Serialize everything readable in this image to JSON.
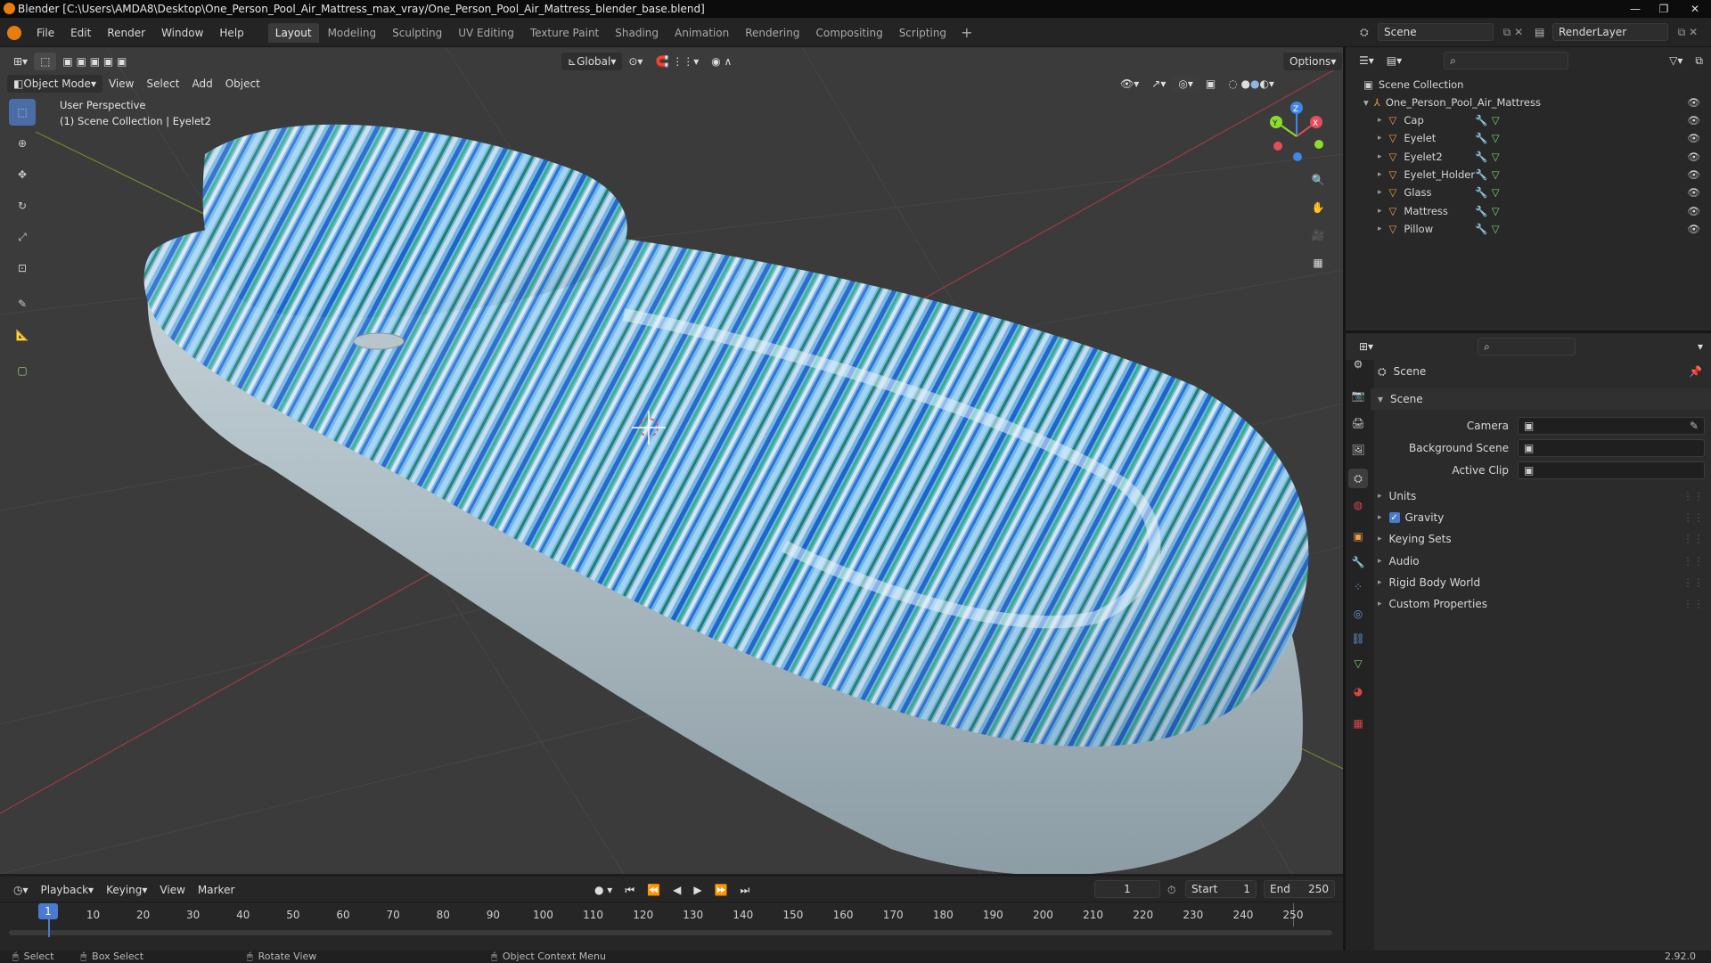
{
  "titlebar": {
    "title": "Blender [C:\\Users\\AMDA8\\Desktop\\One_Person_Pool_Air_Mattress_max_vray/One_Person_Pool_Air_Mattress_blender_base.blend]"
  },
  "menu": [
    "File",
    "Edit",
    "Render",
    "Window",
    "Help"
  ],
  "workspaces": [
    "Layout",
    "Modeling",
    "Sculpting",
    "UV Editing",
    "Texture Paint",
    "Shading",
    "Animation",
    "Rendering",
    "Compositing",
    "Scripting"
  ],
  "active_workspace": "Layout",
  "scene_field": "Scene",
  "render_layer_field": "RenderLayer",
  "viewport_header": {
    "orientation": "Global",
    "options": "Options",
    "mode": "Object Mode",
    "menus": [
      "View",
      "Select",
      "Add",
      "Object"
    ]
  },
  "overlay": {
    "line1": "User Perspective",
    "line2": "(1) Scene Collection | Eyelet2"
  },
  "outliner": {
    "root": "Scene Collection",
    "collection": "One_Person_Pool_Air_Mattress",
    "objects": [
      "Cap",
      "Eyelet",
      "Eyelet2",
      "Eyelet_Holder",
      "Glass",
      "Mattress",
      "Pillow"
    ]
  },
  "properties": {
    "context": "Scene",
    "panel": "Scene",
    "fields": [
      {
        "label": "Camera"
      },
      {
        "label": "Background Scene"
      },
      {
        "label": "Active Clip"
      }
    ],
    "subpanels": [
      "Units",
      "Gravity",
      "Keying Sets",
      "Audio",
      "Rigid Body World",
      "Custom Properties"
    ],
    "gravity_checked": true
  },
  "timeline": {
    "menus": [
      "Playback",
      "Keying",
      "View",
      "Marker"
    ],
    "current_frame": "1",
    "start_label": "Start",
    "start": "1",
    "end_label": "End",
    "end": "250",
    "ticks": [
      "1",
      "10",
      "20",
      "30",
      "40",
      "50",
      "60",
      "70",
      "80",
      "90",
      "100",
      "110",
      "120",
      "130",
      "140",
      "150",
      "160",
      "170",
      "180",
      "190",
      "200",
      "210",
      "220",
      "230",
      "240",
      "250"
    ]
  },
  "status": {
    "select": "Select",
    "box_select": "Box Select",
    "rotate": "Rotate View",
    "context_menu": "Object Context Menu",
    "version": "2.92.0"
  },
  "colors": {
    "accent": "#4a6da7",
    "x_axis": "#e64d5c",
    "y_axis": "#8bdc2c",
    "z_axis": "#3f86e8",
    "object_orange": "#e8a04b",
    "mesh_green": "#7bd36b"
  }
}
